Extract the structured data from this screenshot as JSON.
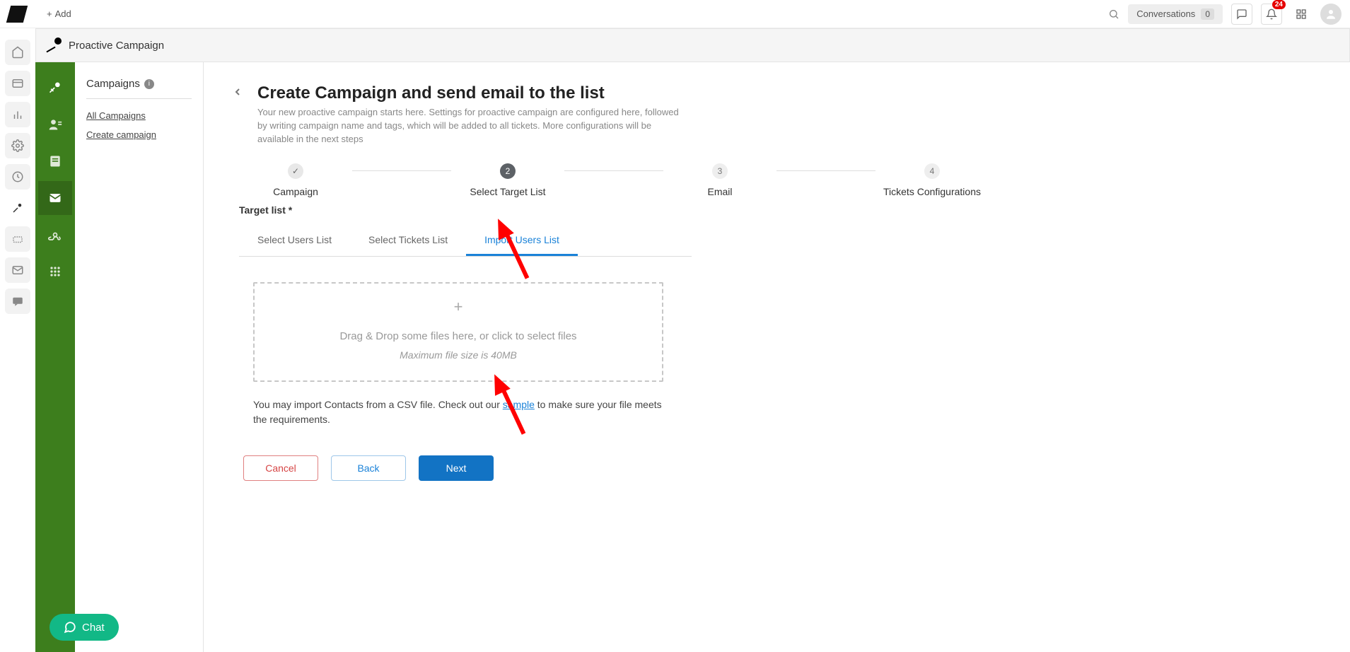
{
  "topbar": {
    "add_label": "Add",
    "conversations_label": "Conversations",
    "conversations_count": "0",
    "notifications_count": "24"
  },
  "header2": {
    "title": "Proactive Campaign"
  },
  "sidebar": {
    "title": "Campaigns",
    "links": {
      "all": "All Campaigns",
      "create": "Create campaign"
    }
  },
  "page": {
    "title": "Create Campaign and send email to the list",
    "description": "Your new proactive campaign starts here. Settings for proactive campaign are configured here, followed by writing campaign name and tags, which will be added to all tickets. More configurations will be available in the next steps"
  },
  "stepper": {
    "s1": {
      "icon": "✓",
      "label": "Campaign"
    },
    "s2": {
      "icon": "2",
      "label": "Select Target List"
    },
    "s3": {
      "icon": "3",
      "label": "Email"
    },
    "s4": {
      "icon": "4",
      "label": "Tickets Configurations"
    }
  },
  "section": {
    "target_list": "Target list *"
  },
  "tabs": {
    "users": "Select Users List",
    "tickets": "Select Tickets List",
    "import": "Import Users List"
  },
  "dropzone": {
    "main": "Drag & Drop some files here, or click to select files",
    "sub": "Maximum file size is 40MB"
  },
  "hint": {
    "pre": "You may import Contacts from a CSV file. Check out our ",
    "link": "sample",
    "post": " to make sure your file meets the requirements."
  },
  "actions": {
    "cancel": "Cancel",
    "back": "Back",
    "next": "Next"
  },
  "chat": {
    "label": "Chat"
  }
}
